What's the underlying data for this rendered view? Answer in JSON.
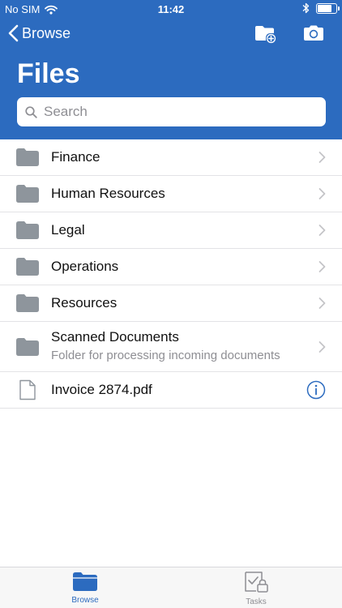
{
  "status_bar": {
    "carrier": "No SIM",
    "time": "11:42",
    "battery_level": 0.8
  },
  "nav": {
    "back_label": "Browse",
    "new_folder_icon": "folder-plus-icon",
    "camera_icon": "camera-icon"
  },
  "page": {
    "title": "Files"
  },
  "search": {
    "placeholder": "Search",
    "value": ""
  },
  "files": [
    {
      "name": "Finance",
      "type": "folder"
    },
    {
      "name": "Human Resources",
      "type": "folder"
    },
    {
      "name": "Legal",
      "type": "folder"
    },
    {
      "name": "Operations",
      "type": "folder"
    },
    {
      "name": "Resources",
      "type": "folder"
    },
    {
      "name": "Scanned Documents",
      "type": "folder",
      "description": "Folder for processing incoming documents"
    },
    {
      "name": "Invoice 2874.pdf",
      "type": "file"
    }
  ],
  "tab_bar": {
    "tabs": [
      {
        "label": "Browse",
        "icon": "folder-icon",
        "active": true
      },
      {
        "label": "Tasks",
        "icon": "task-lock-icon",
        "active": false
      }
    ]
  },
  "colors": {
    "header": "#2c6bbf",
    "accent": "#2c6bbf",
    "folder": "#8e959c",
    "inactive": "#8e8e93"
  }
}
